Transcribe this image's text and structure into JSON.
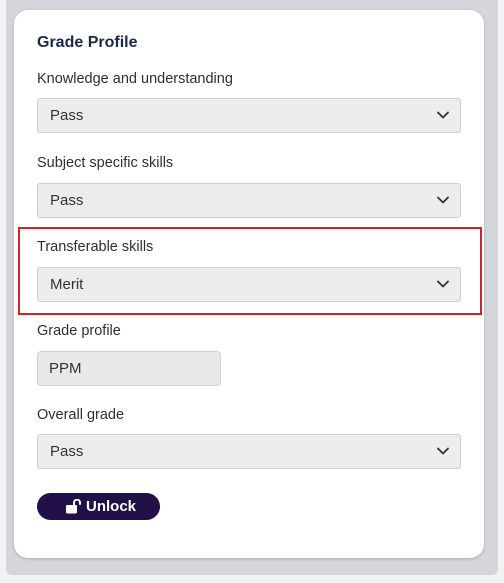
{
  "card": {
    "title": "Grade Profile"
  },
  "fields": {
    "knowledge": {
      "label": "Knowledge and understanding",
      "value": "Pass"
    },
    "subject_skills": {
      "label": "Subject specific skills",
      "value": "Pass"
    },
    "transferable": {
      "label": "Transferable skills",
      "value": "Merit"
    },
    "grade_profile": {
      "label": "Grade profile",
      "value": "PPM"
    },
    "overall": {
      "label": "Overall grade",
      "value": "Pass"
    }
  },
  "actions": {
    "unlock_label": "Unlock"
  },
  "colors": {
    "button_bg": "#221048",
    "highlight_border": "#d3232a",
    "title": "#1b2a4a"
  },
  "icons": {
    "dropdown": "chevron-down-icon",
    "unlock": "unlock-icon"
  }
}
